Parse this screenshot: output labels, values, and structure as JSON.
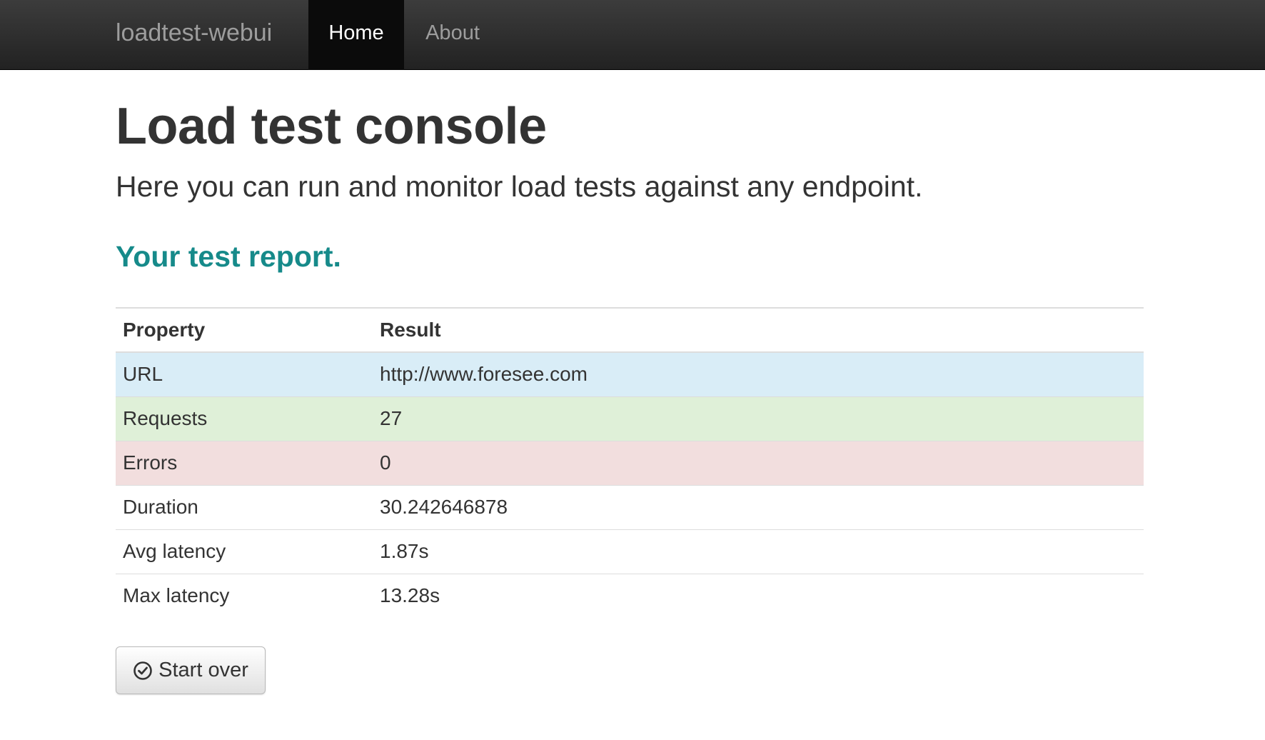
{
  "navbar": {
    "brand": "loadtest-webui",
    "items": [
      {
        "label": "Home",
        "active": true
      },
      {
        "label": "About",
        "active": false
      }
    ]
  },
  "header": {
    "title": "Load test console",
    "lead": "Here you can run and monitor load tests against any endpoint."
  },
  "report": {
    "heading": "Your test report.",
    "columns": [
      "Property",
      "Result"
    ],
    "rows": [
      {
        "property": "URL",
        "result": "http://www.foresee.com",
        "status": "info"
      },
      {
        "property": "Requests",
        "result": "27",
        "status": "success"
      },
      {
        "property": "Errors",
        "result": "0",
        "status": "danger"
      },
      {
        "property": "Duration",
        "result": "30.242646878",
        "status": "default"
      },
      {
        "property": "Avg latency",
        "result": "1.87s",
        "status": "default"
      },
      {
        "property": "Max latency",
        "result": "13.28s",
        "status": "default"
      }
    ]
  },
  "actions": {
    "start_over_label": "Start over",
    "start_over_icon": "check-circle-icon"
  },
  "colors": {
    "navbar_bg": "#222222",
    "heading_accent": "#168a8a",
    "row_info": "#d9edf7",
    "row_success": "#dff0d8",
    "row_danger": "#f2dede"
  }
}
